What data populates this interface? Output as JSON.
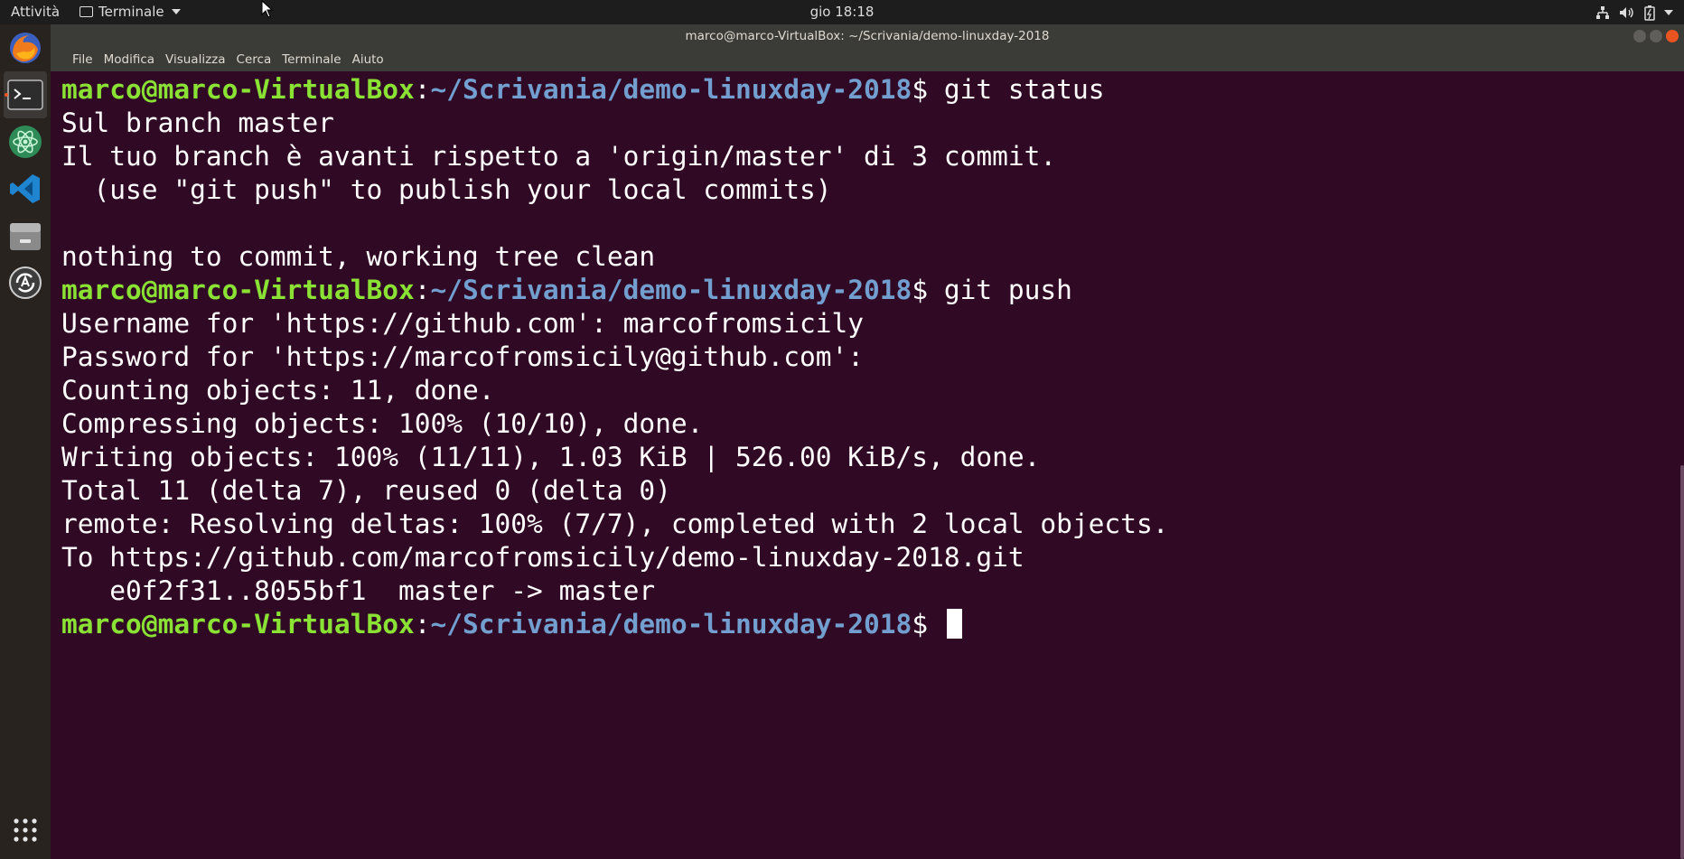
{
  "topbar": {
    "activities": "Attività",
    "app_menu": "Terminale",
    "clock": "gio 18:18",
    "system_icons": [
      "network-icon",
      "volume-icon",
      "battery-icon",
      "power-menu-caret-icon"
    ]
  },
  "dock": {
    "items": [
      {
        "name": "firefox",
        "icon": "firefox-icon",
        "active": false
      },
      {
        "name": "terminal",
        "icon": "terminal-icon",
        "active": true
      },
      {
        "name": "atom",
        "icon": "atom-icon",
        "active": false
      },
      {
        "name": "vscode",
        "icon": "vscode-icon",
        "active": false
      },
      {
        "name": "files",
        "icon": "files-icon",
        "active": false
      },
      {
        "name": "software-updater",
        "icon": "software-updater-icon",
        "active": false
      }
    ],
    "show_apps_icon": "app-grid-icon"
  },
  "window": {
    "title": "marco@marco-VirtualBox: ~/Scrivania/demo-linuxday-2018",
    "menu": [
      "File",
      "Modifica",
      "Visualizza",
      "Cerca",
      "Terminale",
      "Aiuto"
    ]
  },
  "terminal": {
    "prompt_user": "marco@marco-VirtualBox",
    "prompt_sep": ":",
    "prompt_path": "~/Scrivania/demo-linuxday-2018",
    "prompt_end": "$ ",
    "lines": [
      {
        "type": "prompt",
        "cmd": "git status"
      },
      {
        "type": "out",
        "text": "Sul branch master"
      },
      {
        "type": "out",
        "text": "Il tuo branch è avanti rispetto a 'origin/master' di 3 commit."
      },
      {
        "type": "out",
        "text": "  (use \"git push\" to publish your local commits)"
      },
      {
        "type": "out",
        "text": ""
      },
      {
        "type": "out",
        "text": "nothing to commit, working tree clean"
      },
      {
        "type": "prompt",
        "cmd": "git push"
      },
      {
        "type": "out",
        "text": "Username for 'https://github.com': marcofromsicily"
      },
      {
        "type": "out",
        "text": "Password for 'https://marcofromsicily@github.com':"
      },
      {
        "type": "out",
        "text": "Counting objects: 11, done."
      },
      {
        "type": "out",
        "text": "Compressing objects: 100% (10/10), done."
      },
      {
        "type": "out",
        "text": "Writing objects: 100% (11/11), 1.03 KiB | 526.00 KiB/s, done."
      },
      {
        "type": "out",
        "text": "Total 11 (delta 7), reused 0 (delta 0)"
      },
      {
        "type": "out",
        "text": "remote: Resolving deltas: 100% (7/7), completed with 2 local objects."
      },
      {
        "type": "out",
        "text": "To https://github.com/marcofromsicily/demo-linuxday-2018.git"
      },
      {
        "type": "out",
        "text": "   e0f2f31..8055bf1  master -> master"
      },
      {
        "type": "prompt",
        "cmd": "",
        "cursor": true
      }
    ]
  },
  "colors": {
    "terminal_bg": "#300a24",
    "prompt_user": "#8ae234",
    "prompt_path": "#729fcf",
    "accent": "#e95420"
  }
}
